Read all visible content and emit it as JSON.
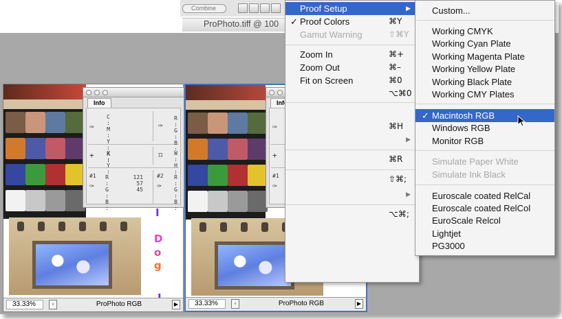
{
  "background_toolbar": {
    "combo_text": "Combine"
  },
  "document": {
    "title": "ProPhoto.tiff @ 100"
  },
  "windows": [
    {
      "zoom": "33.33%",
      "profile": "ProPhoto RGB"
    },
    {
      "zoom": "33.33%",
      "profile": "ProPhoto RGB"
    }
  ],
  "info_palette": {
    "tab": "Info",
    "cmyk_labels": [
      "C :",
      "M :",
      "Y :",
      "K :"
    ],
    "rgb_labels": [
      "R :",
      "G :",
      "B :"
    ],
    "xy_labels": [
      "X :",
      "Y :"
    ],
    "wh_labels": [
      "W :",
      "H :"
    ],
    "sampler1": {
      "tag": "#1",
      "labels": [
        "R :",
        "G :",
        "B :"
      ],
      "values": [
        "121",
        "57",
        "45"
      ]
    },
    "sampler2": {
      "tag": "#2",
      "labels": [
        "R :",
        "G :",
        "B :"
      ],
      "values": [
        "",
        "",
        ""
      ]
    }
  },
  "photo_letters": [
    "I",
    "D",
    "o",
    "g"
  ],
  "view_menu": {
    "items": [
      {
        "label": "Proof Setup",
        "shortcut": "",
        "submenu": true,
        "highlighted": true
      },
      {
        "label": "Proof Colors",
        "shortcut": "⌘Y",
        "checked": true
      },
      {
        "label": "Gamut Warning",
        "shortcut": "⇧⌘Y",
        "disabled": true
      },
      {
        "label": "Zoom In",
        "shortcut": "⌘+"
      },
      {
        "label": "Zoom Out",
        "shortcut": "⌘–"
      },
      {
        "label": "Fit on Screen",
        "shortcut": "⌘0"
      },
      {
        "label": "",
        "shortcut": "⌥⌘0"
      },
      {
        "label": "",
        "shortcut": "⌘H"
      },
      {
        "label": "",
        "shortcut": "",
        "submenu": true
      },
      {
        "label": "",
        "shortcut": "⌘R"
      },
      {
        "label": "",
        "shortcut": "⇧⌘;"
      },
      {
        "label": "",
        "shortcut": "",
        "submenu": true
      },
      {
        "label": "",
        "shortcut": "⌥⌘;"
      }
    ]
  },
  "proof_submenu": {
    "items": [
      {
        "label": "Custom..."
      },
      {
        "label": "Working CMYK"
      },
      {
        "label": "Working Cyan Plate"
      },
      {
        "label": "Working Magenta Plate"
      },
      {
        "label": "Working Yellow Plate"
      },
      {
        "label": "Working Black Plate"
      },
      {
        "label": "Working CMY Plates"
      },
      {
        "label": "Macintosh RGB",
        "checked": true,
        "highlighted": true
      },
      {
        "label": "Windows RGB"
      },
      {
        "label": "Monitor RGB"
      },
      {
        "label": "Simulate Paper White",
        "disabled": true
      },
      {
        "label": "Simulate Ink Black",
        "disabled": true
      },
      {
        "label": "Euroscale coated RelCal"
      },
      {
        "label": "Euroscale coated RelCol"
      },
      {
        "label": "EuroScale Relcol"
      },
      {
        "label": "Lightjet"
      },
      {
        "label": "PG3000"
      }
    ]
  },
  "colors": {
    "menu_highlight": "#3467c9",
    "active_window_border": "#3f73c6",
    "checker_patches": [
      "#7a5c47",
      "#c99679",
      "#5e7aa3",
      "#556b3d",
      "#d27a2a",
      "#4d5aa8",
      "#c05a66",
      "#5e3b6b",
      "#3547a0",
      "#3c9a3e",
      "#b03131",
      "#e3c32b",
      "#f2f2f2",
      "#c8c8c8",
      "#9a9a9a",
      "#6a6a6a"
    ],
    "letter_colors": [
      "#7a2fd6",
      "#e442d2",
      "#d64a9f",
      "#ff6b2f"
    ]
  }
}
